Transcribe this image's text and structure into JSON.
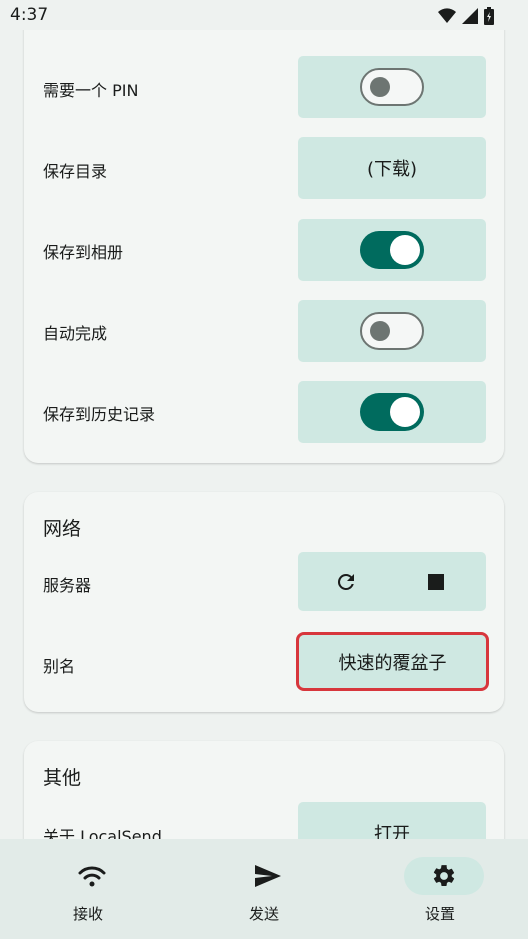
{
  "status_bar": {
    "time": "4:37"
  },
  "receive_settings": {
    "rows": [
      {
        "label": "需要一个 PIN",
        "control": "switch",
        "enabled": false
      },
      {
        "label": "保存目录",
        "control": "button",
        "value": "(下载)"
      },
      {
        "label": "保存到相册",
        "control": "switch",
        "enabled": true
      },
      {
        "label": "自动完成",
        "control": "switch",
        "enabled": false
      },
      {
        "label": "保存到历史记录",
        "control": "switch",
        "enabled": true
      }
    ]
  },
  "network": {
    "title": "网络",
    "server_label": "服务器",
    "alias_label": "别名",
    "alias_value": "快速的覆盆子"
  },
  "other": {
    "title": "其他",
    "about_label": "关于 LocalSend",
    "about_button": "打开"
  },
  "bottom_nav": {
    "items": [
      {
        "label": "接收",
        "icon": "wifi-icon",
        "active": false
      },
      {
        "label": "发送",
        "icon": "send-icon",
        "active": false
      },
      {
        "label": "设置",
        "icon": "gear-icon",
        "active": true
      }
    ]
  },
  "colors": {
    "accent": "#006b5e",
    "tile": "#cfe8e2",
    "highlight_border": "#d7363c",
    "background": "#eef2f0"
  }
}
